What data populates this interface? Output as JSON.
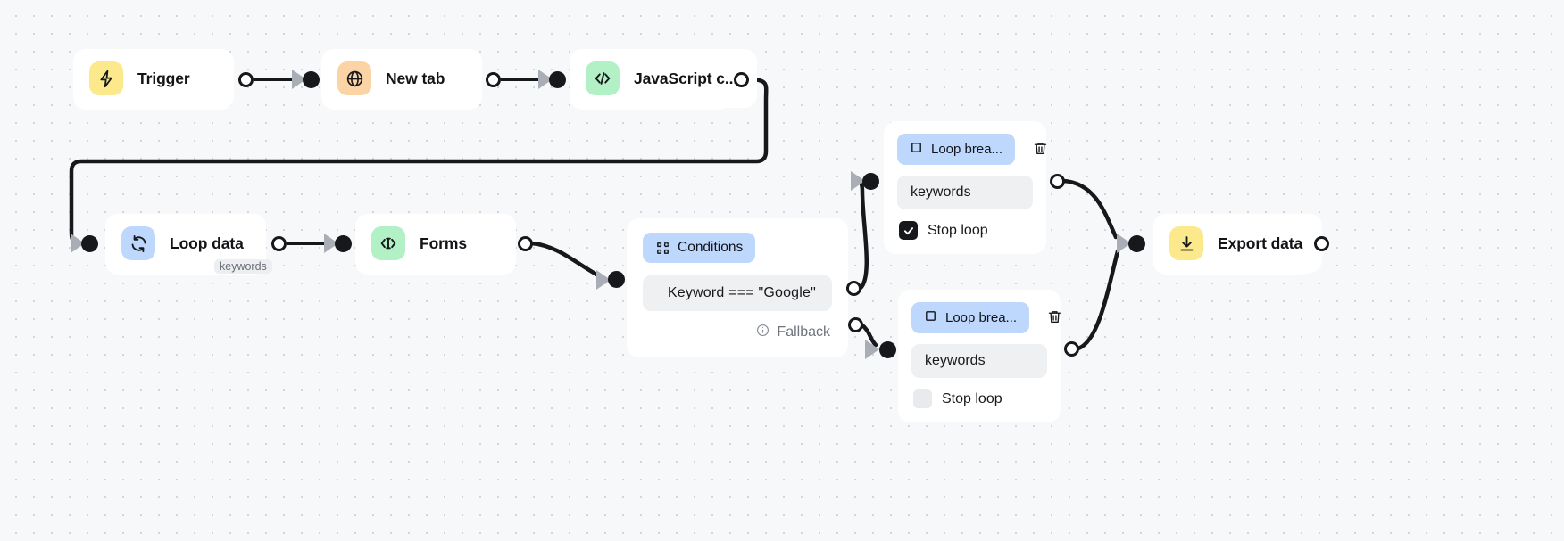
{
  "canvas": {
    "background": "#f7f8f9",
    "dot_color": "#d3d5da"
  },
  "nodes": [
    {
      "id": "trigger",
      "label": "Trigger",
      "icon": "lightning-bolt-icon",
      "icon_bg": "#fbe98b"
    },
    {
      "id": "new-tab",
      "label": "New tab",
      "icon": "globe-icon",
      "icon_bg": "#fbd3a4"
    },
    {
      "id": "javascript-code",
      "label": "JavaScript c...",
      "icon": "code-brackets-icon",
      "icon_bg": "#b2f0c6"
    },
    {
      "id": "loop-data",
      "label": "Loop data",
      "icon": "refresh-loop-icon",
      "icon_bg": "#bed8fd",
      "sub_badge": "keywords"
    },
    {
      "id": "forms",
      "label": "Forms",
      "icon": "form-cursor-icon",
      "icon_bg": "#b2f0c6"
    },
    {
      "id": "export-data",
      "label": "Export data",
      "icon": "download-icon",
      "icon_bg": "#fbe98b"
    }
  ],
  "conditions_panel": {
    "chip_label": "Conditions",
    "chip_icon": "branch-icon",
    "chip_bg": "#bed8fd",
    "condition_text": "Keyword === \"Google\"",
    "fallback_label": "Fallback",
    "fallback_icon": "info-icon"
  },
  "loop_breaks": [
    {
      "id": "loop-break-top",
      "chip_label": "Loop brea...",
      "chip_icon": "square-icon",
      "delete_icon": "trash-icon",
      "keyword_value": "keywords",
      "stop_loop_label": "Stop loop",
      "stop_loop_checked": true
    },
    {
      "id": "loop-break-bottom",
      "chip_label": "Loop brea...",
      "chip_icon": "square-icon",
      "delete_icon": "trash-icon",
      "keyword_value": "keywords",
      "stop_loop_label": "Stop loop",
      "stop_loop_checked": false
    }
  ],
  "colors": {
    "edge": "#16181c",
    "arrow": "#a9adb6",
    "accent_blue": "#bed8fd",
    "accent_yellow": "#fbe98b",
    "accent_green": "#b2f0c6",
    "accent_orange": "#fbd3a4",
    "field_bg": "#eef0f2",
    "muted_text": "#6e727b"
  }
}
